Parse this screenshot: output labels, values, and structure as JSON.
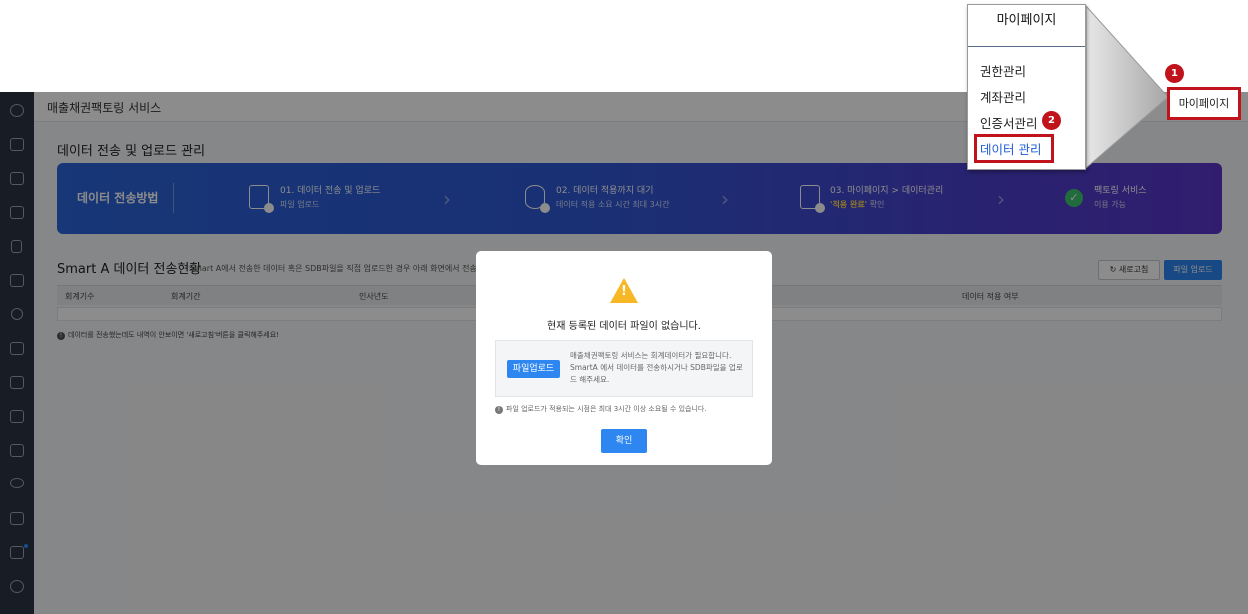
{
  "header": {
    "app_title": "매출채권팩토링 서비스"
  },
  "page_title": "데이터 전송 및 업로드 관리",
  "banner": {
    "label": "데이터 전송방법",
    "steps": [
      {
        "title": "01. 데이터 전송 및 업로드",
        "sub": "파일 업로드"
      },
      {
        "title": "02. 데이터 적용까지 대기",
        "sub": "데이터 적용 소요 시간 최대 3시간"
      },
      {
        "title": "03. 마이페이지 > 데이터관리",
        "sub_highlight": "'적용 완료'",
        "sub_rest": " 확인"
      },
      {
        "title": "팩토링 서비스",
        "sub": "이용 가능"
      }
    ]
  },
  "section": {
    "title": "Smart A 데이터 전송현황",
    "desc": "Smart A에서 전송한 데이터 혹은 SDB파일을 직접 업로드한 경우 아래 화면에서 전송",
    "refresh_label": "새로고침",
    "upload_label": "파일 업로드",
    "columns": [
      "회계기수",
      "회계기간",
      "인사년도",
      "",
      "데이터 적용 여부"
    ],
    "note": "데이터를 전송했는데도 내역이 안보이면 '새로고침'버튼을 클릭해주세요!"
  },
  "modal": {
    "title": "현재 등록된 데이터 파일이 없습니다.",
    "file_button": "파일업로드",
    "file_desc": "매출채권팩토링 서비스는 회계데이터가 필요합니다. SmartA 에서 데이터를 전송하시거나 SDB파일을 업로드 해주세요.",
    "note": "파일 업로드가 적용되는 시점은 최대 3시간 이상 소요될 수 있습니다.",
    "ok_label": "확인"
  },
  "callout": {
    "dropdown_title": "마이페이지",
    "items": [
      "권한관리",
      "계좌관리",
      "인증서관리",
      "데이터 관리"
    ],
    "mypage_label": "마이페이지",
    "badge1": "1",
    "badge2": "2"
  },
  "colors": {
    "sidebar": "#2c3442",
    "accent": "#2e86f0",
    "highlight_red": "#c0131c",
    "warning": "#f8b825"
  }
}
